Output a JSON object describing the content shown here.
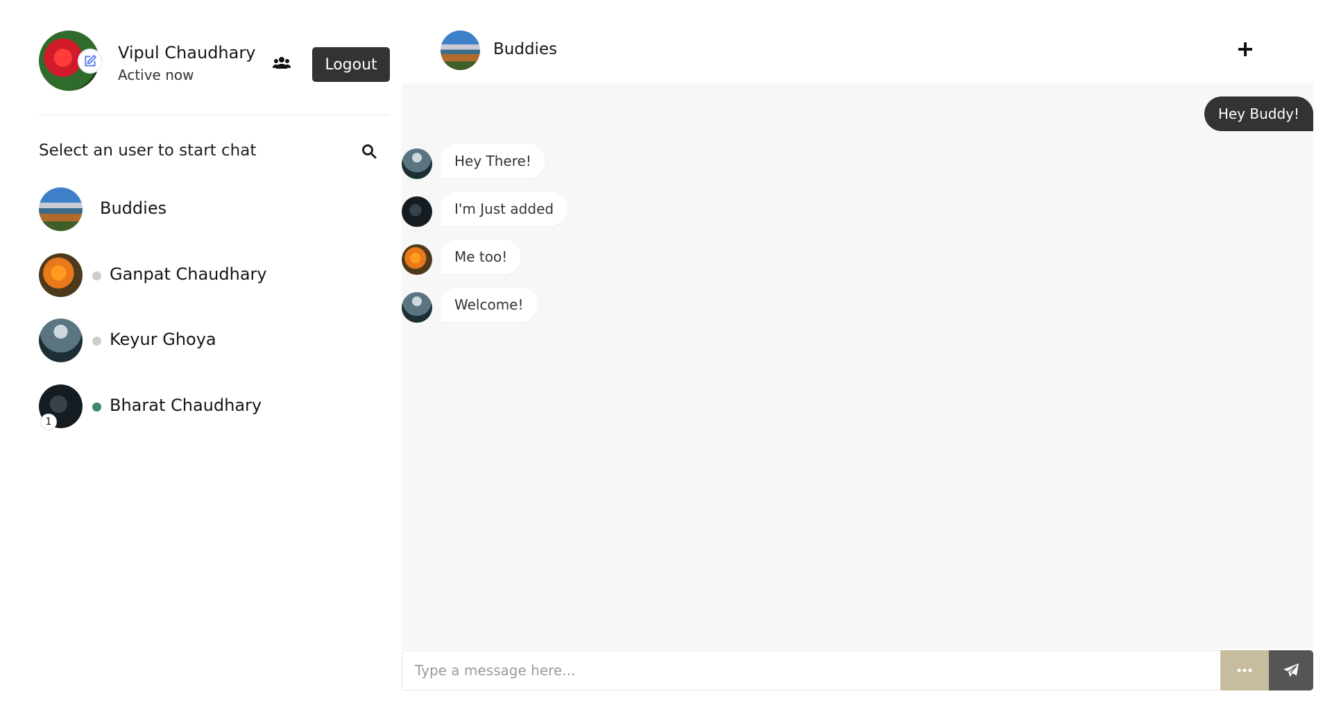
{
  "profile": {
    "name": "Vipul Chaudhary",
    "status": "Active now",
    "logout_label": "Logout"
  },
  "sidebar": {
    "search_prompt": "Select an user to start chat",
    "users": [
      {
        "name": "Buddies",
        "type": "group",
        "avatar": "landscape"
      },
      {
        "name": "Ganpat Chaudhary",
        "online": false,
        "avatar": "marigold"
      },
      {
        "name": "Keyur Ghoya",
        "online": false,
        "avatar": "elephant"
      },
      {
        "name": "Bharat Chaudhary",
        "online": true,
        "avatar": "dark",
        "unread": "1"
      }
    ]
  },
  "chat": {
    "title": "Buddies",
    "messages": [
      {
        "direction": "outgoing",
        "text": "Hey Buddy!"
      },
      {
        "direction": "incoming",
        "text": "Hey There!",
        "avatar": "elephant"
      },
      {
        "direction": "incoming",
        "text": "I'm Just added",
        "avatar": "dark"
      },
      {
        "direction": "incoming",
        "text": "Me too!",
        "avatar": "marigold"
      },
      {
        "direction": "incoming",
        "text": "Welcome!",
        "avatar": "elephant"
      }
    ],
    "input_placeholder": "Type a message here..."
  },
  "icons": {
    "edit": "edit-icon",
    "group": "users-icon",
    "search": "search-icon",
    "add": "plus-icon",
    "more": "ellipsis-icon",
    "send": "send-icon"
  },
  "colors": {
    "dark_button": "#333333",
    "online": "#3e8a67",
    "offline": "#cccccc",
    "accent_edit": "#5b7cf5",
    "more_button": "#c7bd9e",
    "send_button": "#555555",
    "chat_background": "#f7f7f7"
  }
}
